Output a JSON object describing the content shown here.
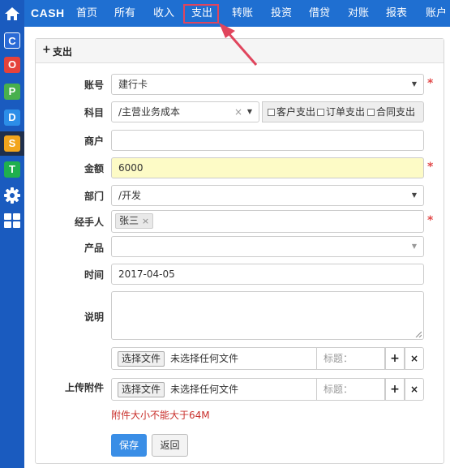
{
  "nav": {
    "brand": "CASH",
    "items": [
      "首页",
      "所有",
      "收入",
      "支出",
      "转账",
      "投资",
      "借贷",
      "对账",
      "报表",
      "账户"
    ],
    "active": "支出"
  },
  "sidebar": {
    "icons": [
      "home-icon",
      "c-app-icon",
      "o-app-icon",
      "p-app-icon",
      "d-app-icon",
      "s-app-icon",
      "t-app-icon",
      "gear-icon",
      "grid-icon"
    ],
    "letters": {
      "c": "C",
      "o": "O",
      "p": "P",
      "d": "D",
      "s": "S",
      "t": "T"
    }
  },
  "panel": {
    "plus": "+",
    "title": "支出"
  },
  "form": {
    "account": {
      "label": "账号",
      "value": "建行卡"
    },
    "subject": {
      "label": "科目",
      "value": "/主营业务成本",
      "clear": "×",
      "options": [
        "客户支出",
        "订单支出",
        "合同支出"
      ]
    },
    "merchant": {
      "label": "商户",
      "value": ""
    },
    "amount": {
      "label": "金额",
      "value": "6000"
    },
    "department": {
      "label": "部门",
      "value": "/开发"
    },
    "handler": {
      "label": "经手人",
      "tag": "张三",
      "tag_remove": "×"
    },
    "product": {
      "label": "产品",
      "value": ""
    },
    "time": {
      "label": "时间",
      "value": "2017-04-05"
    },
    "description": {
      "label": "说明",
      "value": ""
    },
    "attachments": {
      "label": "上传附件",
      "choose_file": "选择文件",
      "no_file": "未选择任何文件",
      "title_placeholder": "标题：",
      "add": "+",
      "remove": "×",
      "size_note": "附件大小不能大于64M"
    },
    "required_mark": "*"
  },
  "buttons": {
    "save": "保存",
    "back": "返回"
  },
  "colors": {
    "nav_bg": "#1f6fd1",
    "sidebar_bg": "#1a5bbf",
    "amount_bg": "#fdfbc6",
    "required": "#e24a4a",
    "save_bg": "#3a8ee6",
    "annotation": "#e0455d"
  }
}
